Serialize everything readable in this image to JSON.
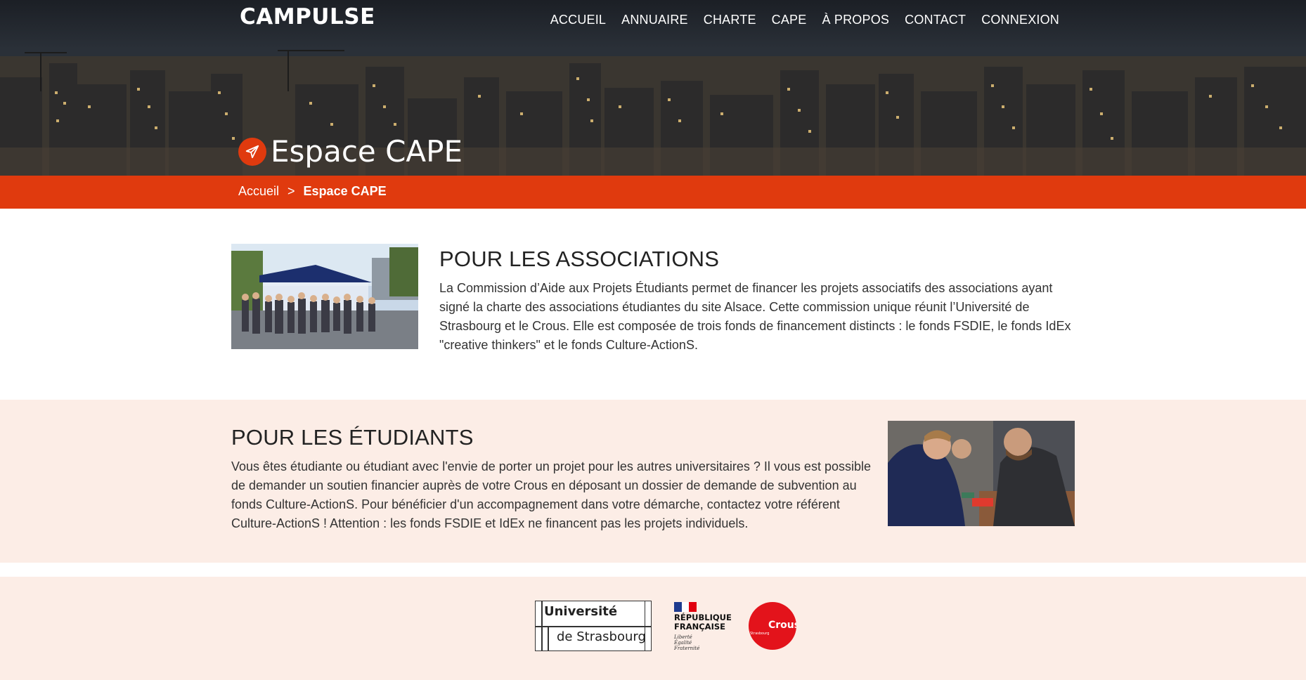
{
  "header": {
    "brand": "CAMPULSE",
    "nav": [
      "ACCUEIL",
      "ANNUAIRE",
      "CHARTE",
      "CAPE",
      "À PROPOS",
      "CONTACT",
      "CONNEXION"
    ]
  },
  "hero": {
    "title": "Espace CAPE",
    "icon": "paper-plane-icon"
  },
  "breadcrumb": {
    "home": "Accueil",
    "separator": ">",
    "current": "Espace CAPE"
  },
  "associations": {
    "heading": "POUR LES ASSOCIATIONS",
    "text": "La Commission d’Aide aux Projets Étudiants permet de financer les projets associatifs des associations ayant signé la charte des associations étudiantes du site Alsace. Cette commission unique réunit l’Université de Strasbourg et le Crous. Elle est composée de trois fonds de financement distincts : le fonds FSDIE, le fonds IdEx \"creative thinkers\" et le fonds Culture-ActionS."
  },
  "etudiants": {
    "heading": "POUR LES ÉTUDIANTS",
    "text": "Vous êtes étudiante ou étudiant avec l'envie de porter un projet pour les autres universitaires ? Il vous est possible de demander un soutien financier auprès de votre Crous en déposant un dossier de demande de subvention au fonds Culture-ActionS. Pour bénéficier d'un accompagnement dans votre démarche, contactez votre référent Culture-ActionS ! Attention : les fonds FSDIE et IdEx ne financent pas les projets individuels."
  },
  "footer": {
    "unistra_line1": "Université",
    "unistra_line2": "de Strasbourg",
    "rf_line1": "RÉPUBLIQUE",
    "rf_line2": "FRANÇAISE",
    "rf_motto1": "Liberté",
    "rf_motto2": "Égalité",
    "rf_motto3": "Fraternité",
    "crous_title": "Crous",
    "crous_sub": "Strasbourg"
  },
  "colors": {
    "accent": "#e03a0e",
    "section_bg": "#fcede6",
    "crous_red": "#e3131b"
  }
}
